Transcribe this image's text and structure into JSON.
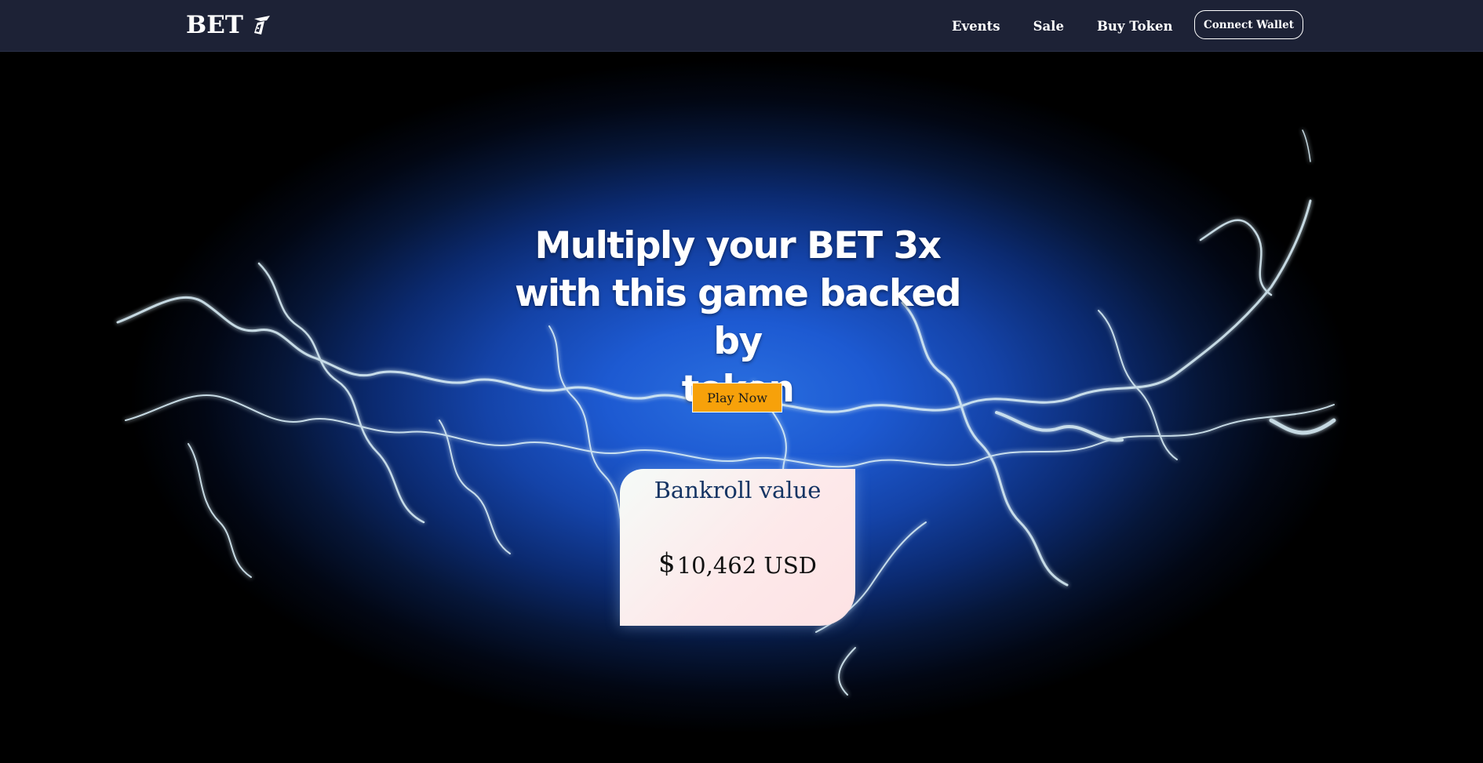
{
  "nav": {
    "brand": "BET",
    "brand_icon": "bet-logo-icon",
    "links": [
      "Events",
      "Sale",
      "Buy Token"
    ],
    "connect_wallet": "Connect Wallet"
  },
  "hero": {
    "title_lines": [
      "Multiply your BET 3x",
      "with this game backed by",
      "token"
    ],
    "play_button": "Play Now"
  },
  "bankroll": {
    "title": "Bankroll value",
    "currency_symbol": "$",
    "amount": "10,462 USD"
  },
  "colors": {
    "navbar_bg": "#1d2236",
    "play_button_bg": "#f7a10a",
    "bankroll_title": "#153463",
    "hero_glow": "#2a6fe0"
  }
}
